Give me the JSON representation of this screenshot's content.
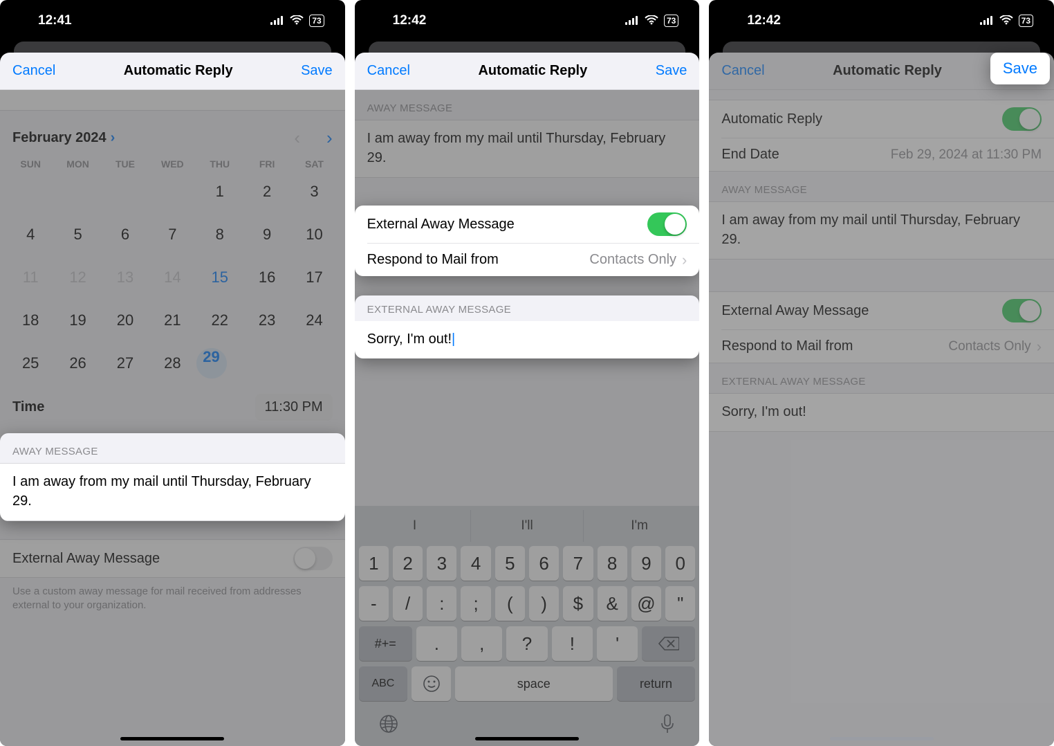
{
  "status": {
    "time1": "12:41",
    "time2": "12:42",
    "time3": "12:42",
    "battery": "73"
  },
  "nav": {
    "cancel": "Cancel",
    "title": "Automatic Reply",
    "save": "Save"
  },
  "p1": {
    "month": "February 2024",
    "dow": [
      "SUN",
      "MON",
      "TUE",
      "WED",
      "THU",
      "FRI",
      "SAT"
    ],
    "time_label": "Time",
    "time_value": "11:30 PM",
    "away_header": "AWAY MESSAGE",
    "away_body": "I am away from my mail until Thursday, February 29.",
    "ext_label": "External Away Message",
    "ext_footer": "Use a custom away message for mail received from addresses external to your organization."
  },
  "calendar": {
    "cells": [
      {
        "t": "",
        "c": ""
      },
      {
        "t": "",
        "c": ""
      },
      {
        "t": "",
        "c": ""
      },
      {
        "t": "",
        "c": ""
      },
      {
        "t": "1",
        "c": ""
      },
      {
        "t": "2",
        "c": ""
      },
      {
        "t": "3",
        "c": ""
      },
      {
        "t": "4",
        "c": ""
      },
      {
        "t": "5",
        "c": ""
      },
      {
        "t": "6",
        "c": ""
      },
      {
        "t": "7",
        "c": ""
      },
      {
        "t": "8",
        "c": ""
      },
      {
        "t": "9",
        "c": ""
      },
      {
        "t": "10",
        "c": ""
      },
      {
        "t": "11",
        "c": "muted"
      },
      {
        "t": "12",
        "c": "muted"
      },
      {
        "t": "13",
        "c": "muted"
      },
      {
        "t": "14",
        "c": "muted"
      },
      {
        "t": "15",
        "c": "today"
      },
      {
        "t": "16",
        "c": ""
      },
      {
        "t": "17",
        "c": ""
      },
      {
        "t": "18",
        "c": ""
      },
      {
        "t": "19",
        "c": ""
      },
      {
        "t": "20",
        "c": ""
      },
      {
        "t": "21",
        "c": ""
      },
      {
        "t": "22",
        "c": ""
      },
      {
        "t": "23",
        "c": ""
      },
      {
        "t": "24",
        "c": ""
      },
      {
        "t": "25",
        "c": ""
      },
      {
        "t": "26",
        "c": ""
      },
      {
        "t": "27",
        "c": ""
      },
      {
        "t": "28",
        "c": ""
      },
      {
        "t": "29",
        "c": "sel"
      },
      {
        "t": "",
        "c": ""
      },
      {
        "t": "",
        "c": ""
      }
    ]
  },
  "p2": {
    "away_header": "AWAY MESSAGE",
    "away_body": "I am away from my mail until Thursday, February 29.",
    "ext_toggle_label": "External Away Message",
    "respond_label": "Respond to Mail from",
    "respond_value": "Contacts Only",
    "ext_msg_header": "EXTERNAL AWAY MESSAGE",
    "ext_msg_body": "Sorry, I'm out!",
    "sugg": [
      "I",
      "I'll",
      "I'm"
    ],
    "row1": [
      "1",
      "2",
      "3",
      "4",
      "5",
      "6",
      "7",
      "8",
      "9",
      "0"
    ],
    "row2": [
      "-",
      "/",
      ":",
      ";",
      "(",
      ")",
      "$",
      "&",
      "@",
      "\""
    ],
    "row3_mode": "#+=",
    "row3": [
      ".",
      ",",
      "?",
      "!",
      "'"
    ],
    "abc": "ABC",
    "space": "space",
    "return": "return"
  },
  "p3": {
    "auto_label": "Automatic Reply",
    "end_label": "End Date",
    "end_value": "Feb 29, 2024 at 11:30 PM",
    "away_header": "AWAY MESSAGE",
    "away_body": "I am away from my mail until Thursday, February 29.",
    "ext_toggle_label": "External Away Message",
    "respond_label": "Respond to Mail from",
    "respond_value": "Contacts Only",
    "ext_msg_header": "EXTERNAL AWAY MESSAGE",
    "ext_msg_body": "Sorry, I'm out!"
  }
}
